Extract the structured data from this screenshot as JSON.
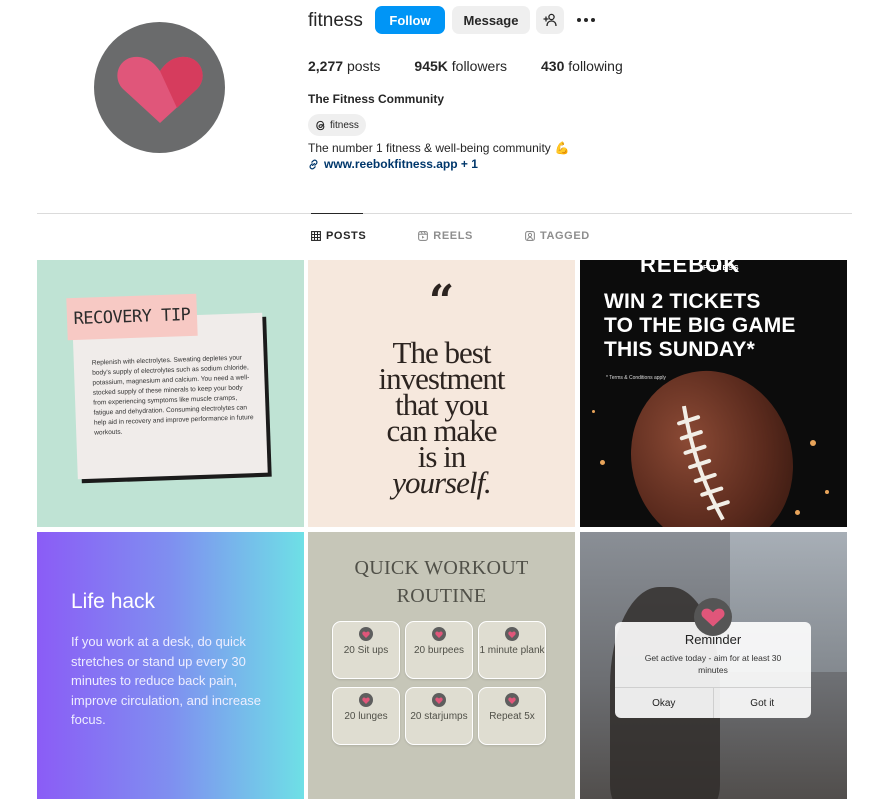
{
  "profile": {
    "username": "fitness",
    "follow_label": "Follow",
    "message_label": "Message",
    "stats": {
      "posts_count": "2,277",
      "posts_label": "posts",
      "followers_count": "945K",
      "followers_label": "followers",
      "following_count": "430",
      "following_label": "following"
    },
    "full_name": "The Fitness Community",
    "threads_handle": "fitness",
    "bio": "The number 1 fitness & well-being community",
    "bio_emoji": "💪",
    "link_text": "www.reebokfitness.app + 1",
    "avatar_color": "#6a6b6c",
    "accent_color": "#0095f6"
  },
  "tabs": [
    {
      "label": "POSTS",
      "icon": "grid-icon",
      "active": true
    },
    {
      "label": "REELS",
      "icon": "reels-icon",
      "active": false
    },
    {
      "label": "TAGGED",
      "icon": "tagged-icon",
      "active": false
    }
  ],
  "posts": {
    "recovery": {
      "label": "RECOVERY TIP",
      "body": "Replenish with electrolytes. Sweating depletes your body's supply of electrolytes such as sodium chloride, potassium, magnesium and calcium. You need a well-stocked supply of these minerals to keep your body from experiencing symptoms like muscle cramps, fatigue and dehydration. Consuming electrolytes can help aid in recovery and improve performance in future workouts."
    },
    "quote": {
      "mark": "“",
      "lines": [
        "The best",
        "investment",
        "that you",
        "can make",
        "is in",
        "yourself."
      ]
    },
    "contest": {
      "brand": "REEBOK",
      "brand_sub": "FITNESS",
      "headline": [
        "WIN 2 TICKETS",
        "TO THE BIG GAME",
        "THIS SUNDAY*"
      ],
      "terms": "* Terms & Conditions apply"
    },
    "lifehack": {
      "title": "Life hack",
      "body": "If you work at a desk, do quick stretches or stand up every 30 minutes to reduce back pain, improve circulation, and increase focus."
    },
    "workout": {
      "title_line1": "QUICK WORKOUT",
      "title_line2": "ROUTINE",
      "items": [
        "20 Sit ups",
        "20 burpees",
        "1 minute plank",
        "20 lunges",
        "20 starjumps",
        "Repeat 5x"
      ]
    },
    "reminder": {
      "title": "Reminder",
      "text": "Get active today - aim for at least 30 minutes",
      "okay_label": "Okay",
      "gotit_label": "Got it"
    }
  }
}
